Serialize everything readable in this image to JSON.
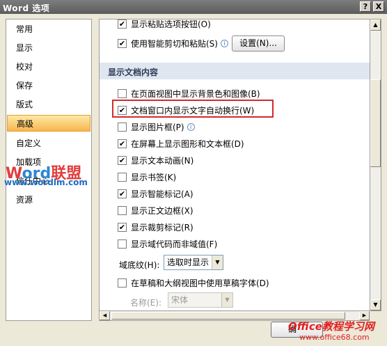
{
  "window": {
    "title": "Word 选项",
    "help_label": "?",
    "close_label": "X"
  },
  "nav": {
    "items": [
      {
        "label": "常用"
      },
      {
        "label": "显示"
      },
      {
        "label": "校对"
      },
      {
        "label": "保存"
      },
      {
        "label": "版式"
      },
      {
        "label": "高级",
        "active": true
      },
      {
        "label": "自定义"
      },
      {
        "label": "加载项"
      },
      {
        "label": "信任中心"
      },
      {
        "label": "资源"
      }
    ]
  },
  "content": {
    "top_options": [
      {
        "label": "显示粘贴选项按钮(O)",
        "checked": true
      },
      {
        "label": "使用智能剪切和粘贴(S)",
        "checked": true,
        "info": true,
        "button_label": "设置(N)..."
      }
    ],
    "section_title": "显示文档内容",
    "options": [
      {
        "label": "在页面视图中显示背景色和图像(B)",
        "checked": false
      },
      {
        "label": "文档窗口内显示文字自动换行(W)",
        "checked": true,
        "highlighted": true
      },
      {
        "label": "显示图片框(P)",
        "checked": false,
        "info": true
      },
      {
        "label": "在屏幕上显示图形和文本框(D)",
        "checked": true
      },
      {
        "label": "显示文本动画(N)",
        "checked": true
      },
      {
        "label": "显示书签(K)",
        "checked": false
      },
      {
        "label": "显示智能标记(A)",
        "checked": true
      },
      {
        "label": "显示正文边框(X)",
        "checked": false
      },
      {
        "label": "显示裁剪标记(R)",
        "checked": true
      },
      {
        "label": "显示域代码而非域值(F)",
        "checked": false
      }
    ],
    "field_shading": {
      "label": "域底纹(H):",
      "value": "选取时显示"
    },
    "draft_font": {
      "label": "在草稿和大纲视图中使用草稿字体(D)",
      "checked": false
    },
    "font_name": {
      "label": "名称(E):",
      "value": "宋体"
    }
  },
  "icons": {
    "check": "check-mark-icon",
    "info": "info-icon",
    "dropdown": "dropdown-arrow-icon"
  },
  "watermarks": {
    "word_w": "W",
    "word_o": "o",
    "word_rd": "rd",
    "word_cn": "联盟",
    "word_url": "www.wordlm.com",
    "office_brand": "Office教程学习网",
    "office_url": "www.office68.com"
  },
  "footer": {
    "ok_partial": "确"
  },
  "colors": {
    "active_nav": "#f8b64c",
    "highlight_box": "#d42a2a",
    "section_bg": "#dfe6f0"
  }
}
